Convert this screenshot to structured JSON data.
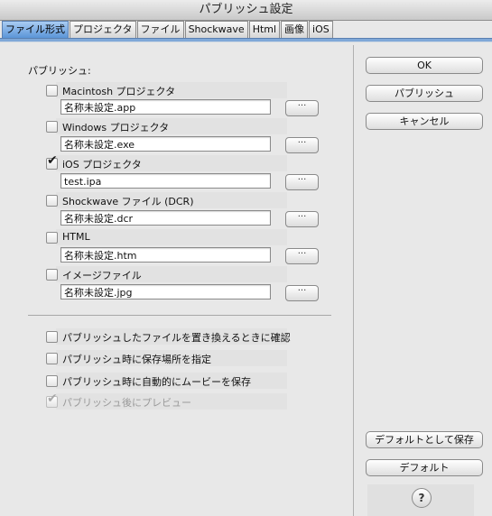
{
  "window": {
    "title": "パブリッシュ設定"
  },
  "tabs": [
    {
      "label": "ファイル形式",
      "active": true
    },
    {
      "label": "プロジェクタ",
      "active": false
    },
    {
      "label": "ファイル",
      "active": false
    },
    {
      "label": "Shockwave",
      "active": false
    },
    {
      "label": "Html",
      "active": false
    },
    {
      "label": "画像",
      "active": false
    },
    {
      "label": "iOS",
      "active": false
    }
  ],
  "publish": {
    "heading": "パブリッシュ:",
    "items": [
      {
        "label": "Macintosh プロジェクタ",
        "checked": false,
        "filename": "名称未設定.app",
        "browse": "···"
      },
      {
        "label": "Windows プロジェクタ",
        "checked": false,
        "filename": "名称未設定.exe",
        "browse": "···"
      },
      {
        "label": "iOS プロジェクタ",
        "checked": true,
        "filename": "test.ipa",
        "browse": "···"
      },
      {
        "label": "Shockwave ファイル (DCR)",
        "checked": false,
        "filename": "名称未設定.dcr",
        "browse": "···"
      },
      {
        "label": "HTML",
        "checked": false,
        "filename": "名称未設定.htm",
        "browse": "···"
      },
      {
        "label": "イメージファイル",
        "checked": false,
        "filename": "名称未設定.jpg",
        "browse": "···"
      }
    ]
  },
  "options": [
    {
      "label": "パブリッシュしたファイルを置き換えるときに確認",
      "checked": false,
      "disabled": false
    },
    {
      "label": "パブリッシュ時に保存場所を指定",
      "checked": false,
      "disabled": false
    },
    {
      "label": "パブリッシュ時に自動的にムービーを保存",
      "checked": false,
      "disabled": false
    },
    {
      "label": "パブリッシュ後にプレビュー",
      "checked": true,
      "disabled": true
    }
  ],
  "buttons": {
    "ok": "OK",
    "publish": "パブリッシュ",
    "cancel": "キャンセル",
    "save_default": "デフォルトとして保存",
    "default": "デフォルト",
    "help": "?"
  }
}
